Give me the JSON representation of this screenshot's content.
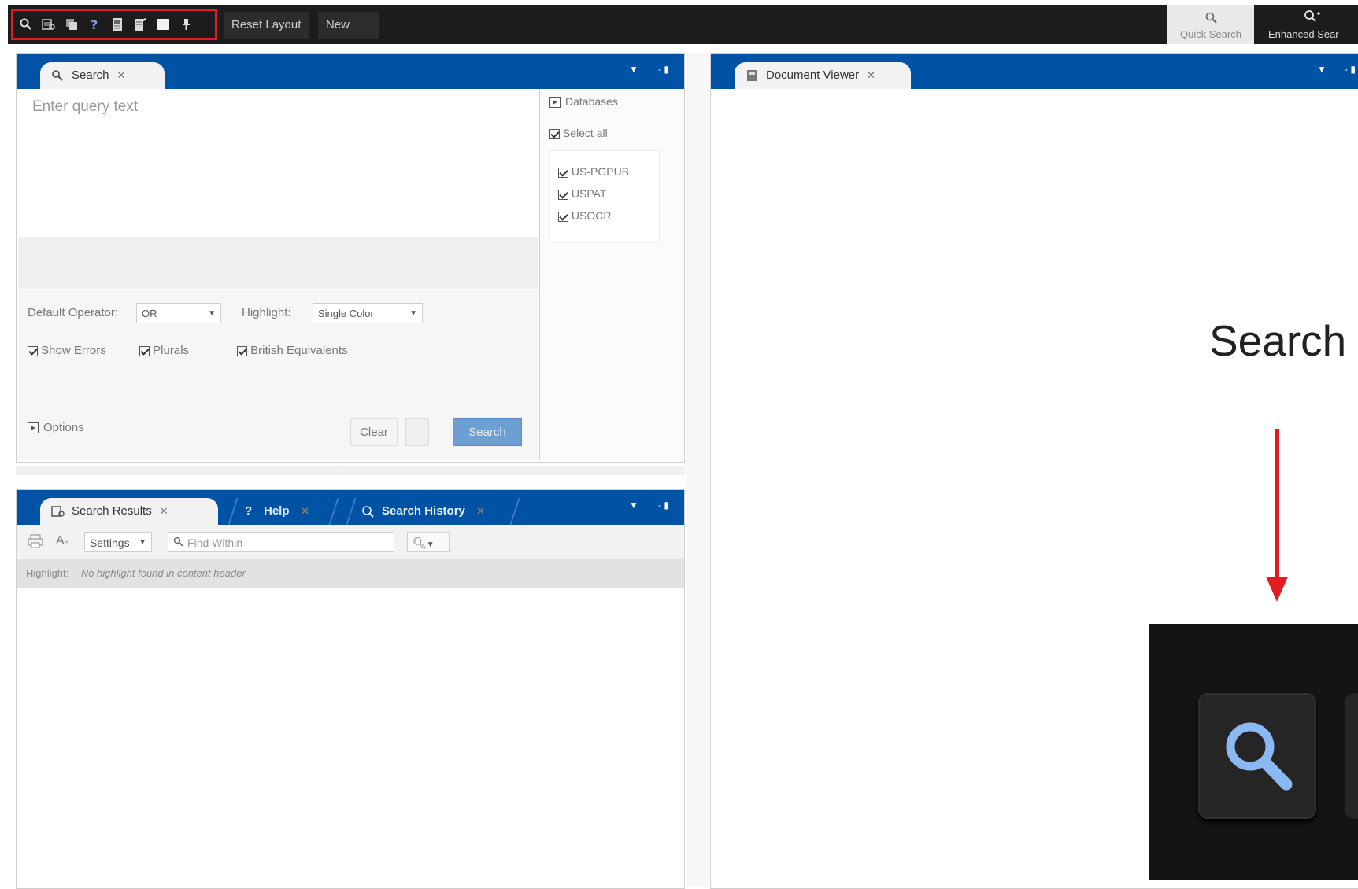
{
  "toolbar": {
    "icons": [
      "search-icon",
      "search-results-icon",
      "copy-icon",
      "help-icon",
      "document-icon",
      "notes-icon",
      "window-icon",
      "pin-icon"
    ],
    "reset_layout": "Reset Layout",
    "new": "New",
    "quick_search": "Quick Search",
    "enhanced_search": "Enhanced Sear",
    "highlight_color": "#e31b23"
  },
  "search_panel": {
    "tab_label": "Search",
    "placeholder": "Enter query text",
    "databases_label": "Databases",
    "select_all": "Select all",
    "databases": [
      "US-PGPUB",
      "USPAT",
      "USOCR"
    ],
    "default_operator_label": "Default Operator:",
    "default_operator_value": "OR",
    "highlight_label": "Highlight:",
    "highlight_value": "Single Color",
    "show_errors": "Show Errors",
    "plurals": "Plurals",
    "british_equivalents": "British Equivalents",
    "options": "Options",
    "clear": "Clear",
    "search": "Search"
  },
  "results_panel": {
    "tabs": [
      "Search Results",
      "Help",
      "Search History"
    ],
    "settings": "Settings",
    "find_within": "Find Within",
    "highlight_label": "Highlight:",
    "highlight_message": "No highlight found in content header"
  },
  "viewer_panel": {
    "tab_label": "Document Viewer"
  },
  "callout": {
    "title": "Search",
    "arrow_color": "#e31b23",
    "icon_color": "#8ab8f0"
  },
  "colors": {
    "accent": "#0052a5",
    "toolbar_bg": "#1c1c1c",
    "primary_button": "#6e9fd3"
  }
}
